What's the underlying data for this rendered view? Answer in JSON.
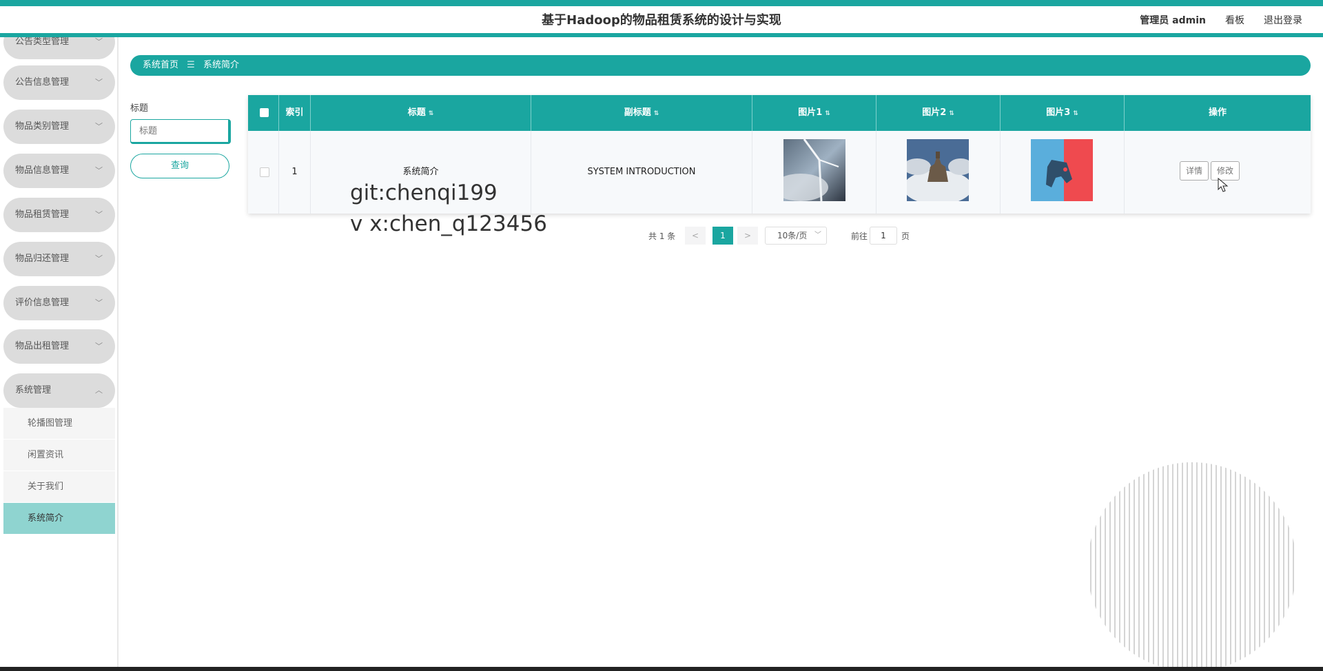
{
  "header": {
    "title": "基于Hadoop的物品租赁系统的设计与实现",
    "user": "管理员 admin",
    "dashboard": "看板",
    "logout": "退出登录"
  },
  "sidebar": {
    "items": [
      {
        "label": "公告类型管理"
      },
      {
        "label": "公告信息管理"
      },
      {
        "label": "物品类别管理"
      },
      {
        "label": "物品信息管理"
      },
      {
        "label": "物品租赁管理"
      },
      {
        "label": "物品归还管理"
      },
      {
        "label": "评价信息管理"
      },
      {
        "label": "物品出租管理"
      },
      {
        "label": "系统管理"
      }
    ],
    "subitems": [
      {
        "label": "轮播图管理"
      },
      {
        "label": "闲置资讯"
      },
      {
        "label": "关于我们"
      },
      {
        "label": "系统简介"
      }
    ]
  },
  "breadcrumb": {
    "home": "系统首页",
    "current": "系统简介"
  },
  "search": {
    "label": "标题",
    "placeholder": "标题",
    "button": "查询"
  },
  "table": {
    "columns": [
      "索引",
      "标题",
      "副标题",
      "图片1",
      "图片2",
      "图片3",
      "操作"
    ],
    "rows": [
      {
        "index": "1",
        "title": "系统简介",
        "subtitle": "SYSTEM INTRODUCTION",
        "detail": "详情",
        "edit": "修改"
      }
    ]
  },
  "watermark": {
    "line1": "git:chenqi199",
    "line2": "v x:chen_q123456"
  },
  "pagination": {
    "total": "共 1 条",
    "prev": "<",
    "current": "1",
    "next": ">",
    "page_size": "10条/页",
    "goto": "前往",
    "goto_value": "1",
    "page_unit": "页"
  },
  "colors": {
    "accent": "#1aa6a0"
  }
}
